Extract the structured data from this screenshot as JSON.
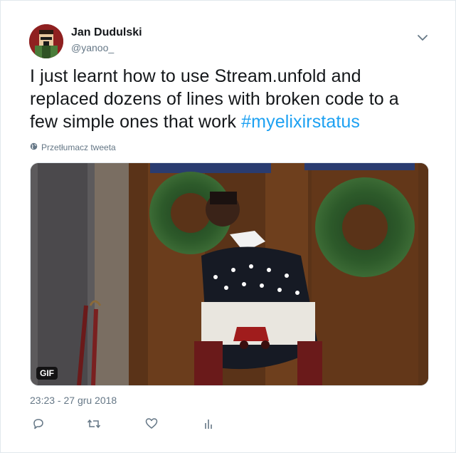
{
  "author": {
    "name": "Jan Dudulski",
    "handle": "@yanoo_"
  },
  "tweet": {
    "text": "I just learnt how to use Stream.unfold and replaced dozens of lines with broken code to a few simple ones that work ",
    "hashtag": "#myelixirstatus"
  },
  "translate_label": "Przetłumacz tweeta",
  "media": {
    "badge": "GIF"
  },
  "timestamp": "23:23 - 27 gru 2018",
  "icons": {
    "menu": "chevron-down-icon",
    "translate": "globe-icon",
    "reply": "reply-icon",
    "retweet": "retweet-icon",
    "like": "heart-icon",
    "analytics": "analytics-icon"
  },
  "colors": {
    "hashtag": "#1da1f2",
    "secondary_text": "#657786"
  }
}
